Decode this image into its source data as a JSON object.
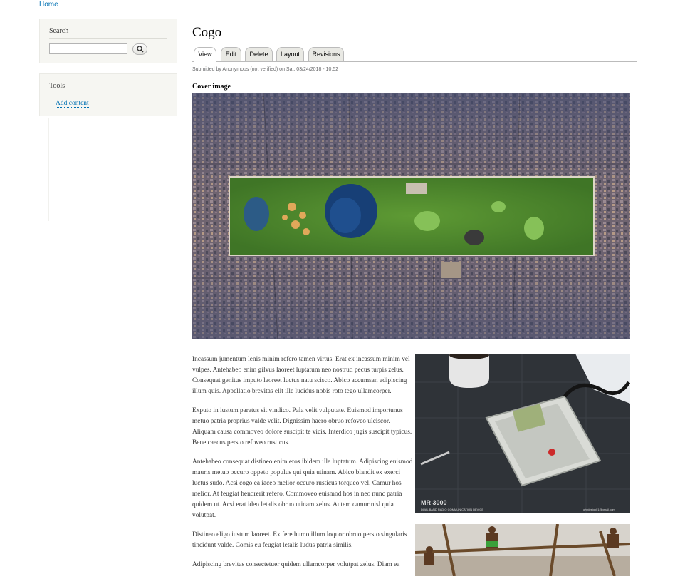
{
  "breadcrumb": {
    "home": "Home"
  },
  "sidebar": {
    "search": {
      "title": "Search",
      "input_value": "",
      "button_icon": "search-icon"
    },
    "tools": {
      "title": "Tools",
      "link": "Add content"
    }
  },
  "page": {
    "title": "Cogo",
    "tabs": [
      {
        "label": "View",
        "active": true
      },
      {
        "label": "Edit",
        "active": false
      },
      {
        "label": "Delete",
        "active": false
      },
      {
        "label": "Layout",
        "active": false
      },
      {
        "label": "Revisions",
        "active": false
      }
    ],
    "submitted": "Submitted by Anonymous (not verified) on Sat, 03/24/2018 - 10:52",
    "field_label": "Cover image",
    "photo1_caption": {
      "title": "MR 3000",
      "subtitle": "DUAL BAND RADIO COMMUNICATION DEVICE",
      "credit": "ofwdesign01@gmail.com"
    },
    "body": [
      "Incassum jumentum lenis minim refero tamen virtus. Erat ex incassum minim vel vulpes. Antehabeo enim gilvus laoreet luptatum neo nostrud pecus turpis zelus. Consequat genitus imputo laoreet luctus natu scisco. Abico accumsan adipiscing illum quis. Appellatio brevitas elit ille lucidus nobis roto tego ullamcorper.",
      "Exputo in iustum paratus sit vindico. Pala velit vulputate. Euismod importunus metuo patria proprius valde velit. Dignissim haero obruo refoveo ulciscor. Aliquam causa commoveo dolore suscipit te vicis. Interdico jugis suscipit typicus. Bene caecus persto refoveo rusticus.",
      "Antehabeo consequat distineo enim eros ibidem ille luptatum. Adipiscing euismod mauris metuo occuro oppeto populus qui quia utinam. Abico blandit ex exerci luctus sudo. Acsi cogo ea iaceo melior occuro rusticus torqueo vel. Camur hos melior. At feugiat hendrerit refero. Commoveo euismod hos in neo nunc patria quidem ut. Acsi erat ideo letalis obruo utinam zelus. Autem camur nisl quia volutpat.",
      "Distineo eligo iustum laoreet. Ex fere humo illum loquor obruo persto singularis tincidunt valde. Comis eu feugiat letalis ludus patria similis.",
      "Adipiscing brevitas consectetuer quidem ullamcorper volutpat zelus. Diam ea"
    ]
  }
}
